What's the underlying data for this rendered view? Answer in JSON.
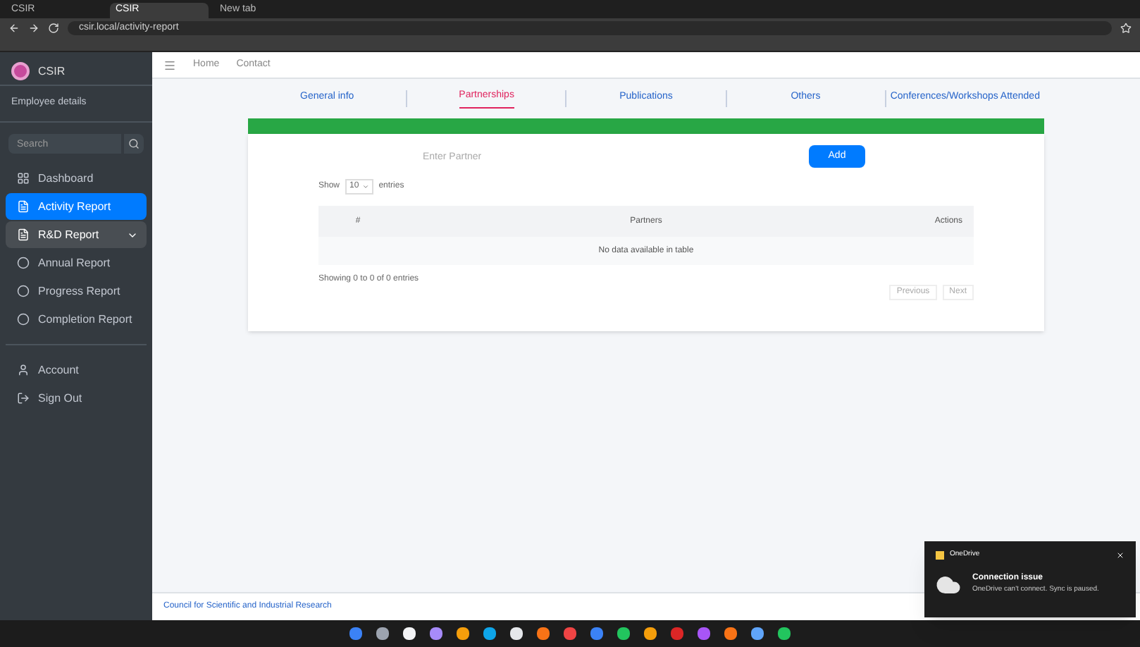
{
  "browser": {
    "address": "csir.local/activity-report",
    "tabs": [
      {
        "title": "CSIR",
        "selected": false
      },
      {
        "title": "CSIR",
        "selected": true
      },
      {
        "title": "New tab",
        "selected": false
      }
    ]
  },
  "brand": {
    "name": "CSIR"
  },
  "user": {
    "name": "Employee details"
  },
  "sidebar": {
    "search_placeholder": "Search",
    "items": [
      {
        "label": "Dashboard",
        "kind": "link",
        "selected": false
      },
      {
        "label": "Activity Report",
        "kind": "link",
        "selected": true
      },
      {
        "label": "R&D Report",
        "kind": "parent",
        "selected": false,
        "expanded": true
      },
      {
        "label": "Annual Report",
        "kind": "sub",
        "selected": false
      },
      {
        "label": "Progress Report",
        "kind": "sub",
        "selected": false
      },
      {
        "label": "Completion Report",
        "kind": "sub",
        "selected": false
      },
      {
        "label": "Account",
        "kind": "link2",
        "selected": false
      },
      {
        "label": "Sign Out",
        "kind": "link2",
        "selected": false
      }
    ]
  },
  "header": {
    "links": [
      "Home",
      "Contact"
    ]
  },
  "tabs": [
    {
      "label": "General info",
      "selected": false
    },
    {
      "label": "Partnerships",
      "selected": true
    },
    {
      "label": "Publications",
      "selected": false
    },
    {
      "label": "Others",
      "selected": false
    },
    {
      "label": "Conferences/Workshops Attended",
      "selected": false
    }
  ],
  "progress": {
    "level": 1
  },
  "form": {
    "placeholder": "Enter Partner",
    "button": "Add"
  },
  "table": {
    "show": "Show",
    "entries_value": "10",
    "entries": "entries",
    "columns": [
      "#",
      "Partners",
      "Actions"
    ],
    "empty": "No data available in table",
    "info": "Showing 0 to 0 of 0 entries",
    "previous": "Previous",
    "next": "Next"
  },
  "footer": {
    "text": "Council for Scientific and Industrial Research"
  },
  "toast": {
    "app": "OneDrive",
    "title": "Connection issue",
    "body": "OneDrive can't connect. Sync is paused."
  }
}
